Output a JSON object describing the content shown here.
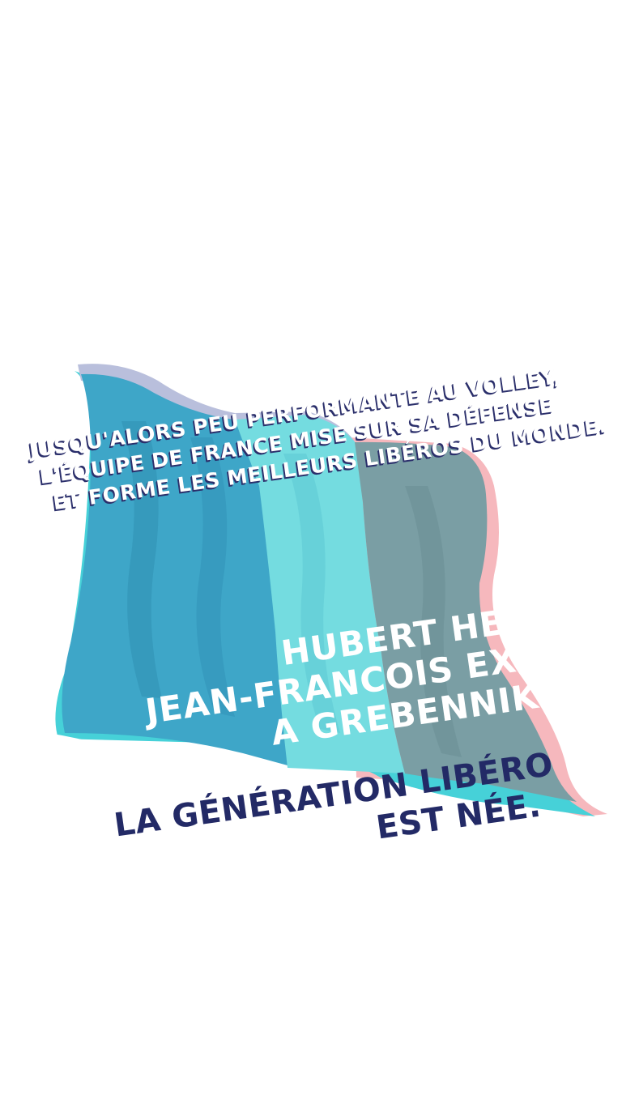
{
  "intro": {
    "line1": "Jusqu'alors peu performante au volley,",
    "line2": "l'équipe de France mise sur sa défense",
    "line3": "et forme les meilleurs libéros du monde."
  },
  "names": {
    "line1": "Hubert Henn",
    "line2": "Jean-Francois Exiga",
    "line3": "a Grebennikov"
  },
  "tagline": {
    "line1": "La génération libéro",
    "line2": "est née."
  },
  "colors": {
    "flag_blue": "#3ea6c8",
    "flag_blue_dark": "#2f8fb3",
    "flag_cyan": "#74dce0",
    "flag_grey": "#7a9ea4",
    "flag_pink": "#f6b8bd",
    "flag_edge_cyan": "#46d1d8",
    "flag_top_lavender": "#b9bfdc",
    "text_navy": "#232a66",
    "text_white": "#ffffff"
  }
}
